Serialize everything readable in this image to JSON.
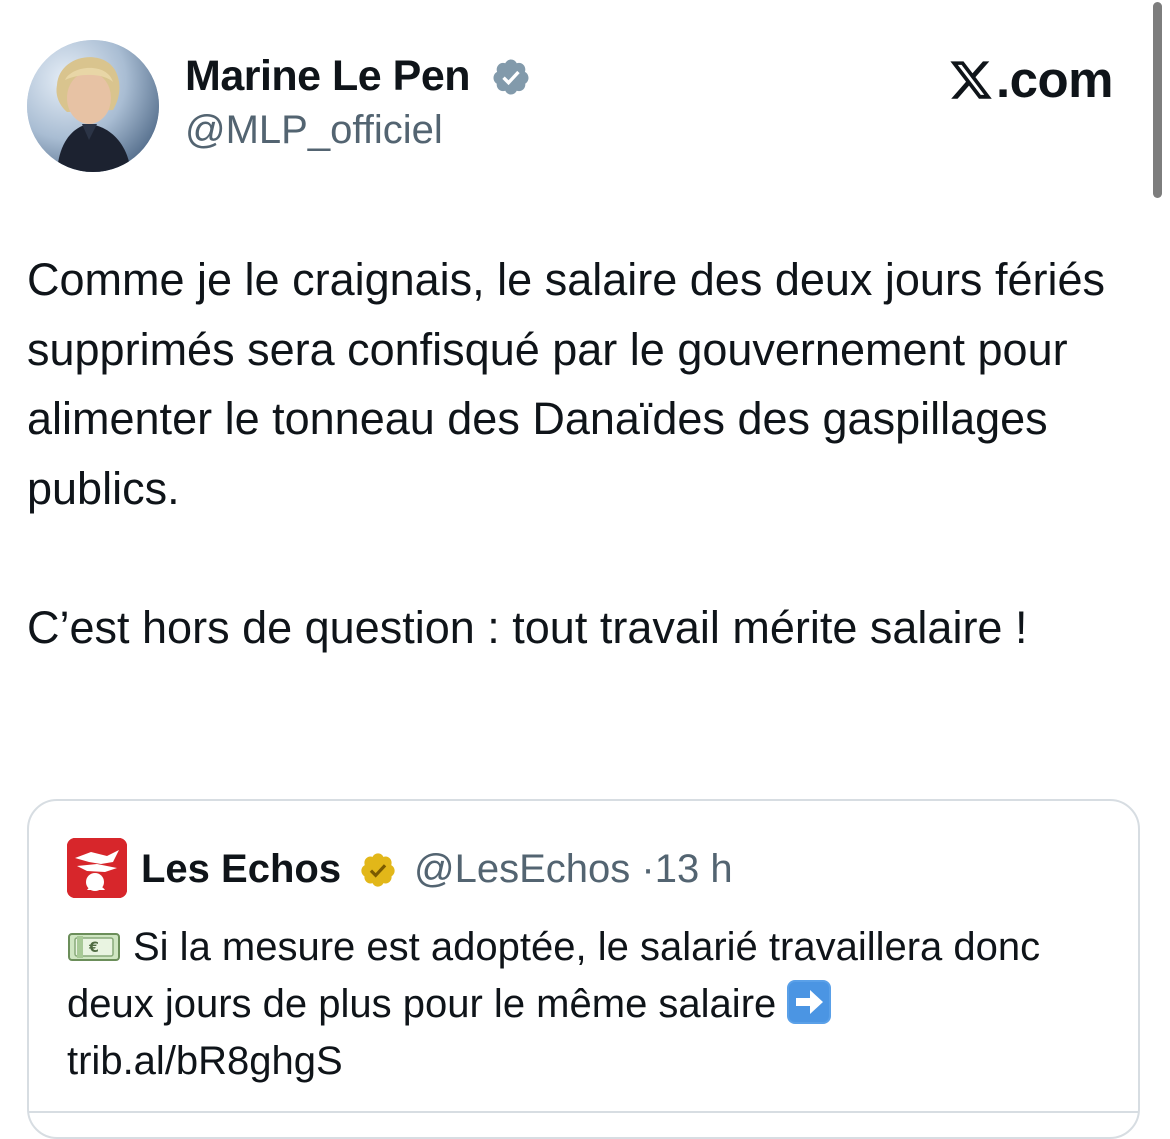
{
  "tweet": {
    "author_name": "Marine Le Pen",
    "author_handle": "@MLP_officiel",
    "platform_label": ".com",
    "body_paragraphs": [
      "Comme je le craignais, le salaire des deux jours fériés supprimés sera confisqué par le gouvernement pour alimenter le tonneau des Danaïdes des gaspillages publics.",
      "C’est hors de question : tout travail mérite salaire !"
    ]
  },
  "quoted_tweet": {
    "author_name": "Les Echos",
    "author_handle": "@LesEchos",
    "separator": "·",
    "time": "13 h",
    "text": "Si la mesure est adoptée, le salarié travaillera donc deux jours de plus pour le même salaire",
    "link": "trib.al/bR8ghgS"
  },
  "icons": {
    "author_badge": "verified-badge-icon",
    "quoted_badge": "gold-verified-badge-icon",
    "logo": "x-logo-icon",
    "emoji_start": "money-bill-icon",
    "emoji_end": "right-arrow-icon"
  },
  "colors": {
    "text_primary": "#0f1419",
    "text_secondary": "#536471",
    "verified_blue": "#829aab",
    "verified_gold": "#e2b719",
    "les_echos_red": "#d7262b",
    "border": "#d7dde2"
  }
}
